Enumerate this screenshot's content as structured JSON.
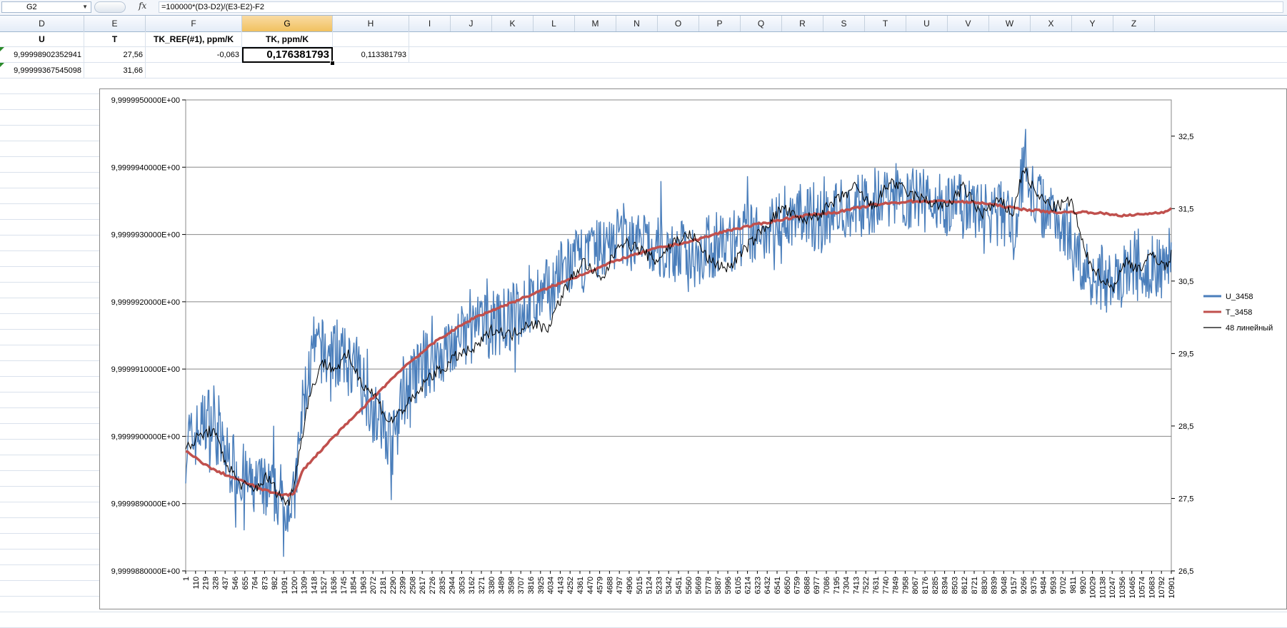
{
  "formula_bar": {
    "name_box": "G2",
    "fx_icon": "fx-icon",
    "formula": "=100000*(D3-D2)/(E3-E2)-F2"
  },
  "columns": [
    "D",
    "E",
    "F",
    "G",
    "H",
    "I",
    "J",
    "K",
    "L",
    "M",
    "N",
    "O",
    "P",
    "Q",
    "R",
    "S",
    "T",
    "U",
    "V",
    "W",
    "X",
    "Y",
    "Z"
  ],
  "selected_column": "G",
  "row1": {
    "d": "U",
    "e": "T",
    "f": "TK_REF(#1), ppm/K",
    "g": "TK, ppm/K"
  },
  "row2": {
    "d": "9,99998902352941",
    "e": "27,56",
    "f": "-0,063",
    "g": "0,176381793",
    "h": "0,113381793"
  },
  "row3": {
    "d": "9,99999367545098",
    "e": "31,66"
  },
  "colors": {
    "u_series": "#4a7ebb",
    "t_series": "#c0504d",
    "ma_series": "#000000",
    "selected_header": "#f1c15f"
  },
  "chart_data": {
    "type": "line",
    "title": "",
    "x_tick_labels": [
      "1",
      "110",
      "219",
      "328",
      "437",
      "546",
      "655",
      "764",
      "873",
      "982",
      "1091",
      "1200",
      "1309",
      "1418",
      "1527",
      "1636",
      "1745",
      "1854",
      "1963",
      "2072",
      "2181",
      "2290",
      "2399",
      "2508",
      "2617",
      "2726",
      "2835",
      "2944",
      "3053",
      "3162",
      "3271",
      "3380",
      "3489",
      "3598",
      "3707",
      "3816",
      "3925",
      "4034",
      "4143",
      "4252",
      "4361",
      "4470",
      "4579",
      "4688",
      "4797",
      "4906",
      "5015",
      "5124",
      "5233",
      "5342",
      "5451",
      "5560",
      "5669",
      "5778",
      "5887",
      "5996",
      "6105",
      "6214",
      "6323",
      "6432",
      "6541",
      "6650",
      "6759",
      "6868",
      "6977",
      "7086",
      "7195",
      "7304",
      "7413",
      "7522",
      "7631",
      "7740",
      "7849",
      "7958",
      "8067",
      "8176",
      "8285",
      "8394",
      "8503",
      "8612",
      "8721",
      "8830",
      "8939",
      "9048",
      "9157",
      "9266",
      "9375",
      "9484",
      "9593",
      "9702",
      "9811",
      "9920",
      "10029",
      "10138",
      "10247",
      "10356",
      "10465",
      "10574",
      "10683",
      "10792",
      "10901"
    ],
    "x_range": [
      1,
      10901
    ],
    "y_left": {
      "labels": [
        "9,9999950000E+00",
        "9,9999940000E+00",
        "9,9999930000E+00",
        "9,9999920000E+00",
        "9,9999910000E+00",
        "9,9999900000E+00",
        "9,9999890000E+00",
        "9,9999880000E+00"
      ],
      "range": [
        9.999988,
        9.999995
      ]
    },
    "y_right": {
      "labels": [
        "32,5",
        "31,5",
        "30,5",
        "29,5",
        "28,5",
        "27,5",
        "26,5"
      ],
      "range": [
        26.5,
        33.0
      ]
    },
    "grid": true,
    "legend_position": "right",
    "series": [
      {
        "name": "U_3458",
        "axis": "left",
        "color": "#4a7ebb",
        "x": [
          1,
          250,
          450,
          700,
          900,
          1100,
          1200,
          1300,
          1420,
          1650,
          1900,
          2100,
          2300,
          2400,
          2600,
          2900,
          3200,
          3500,
          3900,
          4200,
          4500,
          4800,
          5200,
          5600,
          6000,
          6300,
          6600,
          7000,
          7400,
          7800,
          8200,
          8600,
          9000,
          9200,
          9266,
          9400,
          9700,
          9900,
          10100,
          10300,
          10500,
          10800,
          10901
        ],
        "y": [
          9.9999898,
          9.9999903,
          9.9999897,
          9.9999893,
          9.9999892,
          9.9999891,
          9.999989,
          9.9999905,
          9.9999913,
          9.9999912,
          9.999991,
          9.9999903,
          9.9999899,
          9.9999906,
          9.999991,
          9.9999913,
          9.9999916,
          9.9999917,
          9.999992,
          9.9999925,
          9.9999927,
          9.999993,
          9.9999928,
          9.9999927,
          9.9999929,
          9.999993,
          9.9999933,
          9.9999932,
          9.9999934,
          9.9999936,
          9.9999935,
          9.9999934,
          9.9999933,
          9.9999932,
          9.9999941,
          9.9999935,
          9.9999932,
          9.9999925,
          9.9999924,
          9.9999922,
          9.9999926,
          9.9999925,
          9.9999928
        ]
      },
      {
        "name": "T_3458",
        "axis": "right",
        "color": "#c0504d",
        "x": [
          1,
          300,
          600,
          900,
          1100,
          1200,
          1300,
          1600,
          2000,
          2400,
          2800,
          3200,
          3600,
          4000,
          4400,
          4800,
          5200,
          5600,
          6000,
          6400,
          6800,
          7200,
          7600,
          8000,
          8400,
          8800,
          9200,
          9600,
          10000,
          10400,
          10800,
          10901
        ],
        "y": [
          28.15,
          27.9,
          27.75,
          27.6,
          27.55,
          27.56,
          27.9,
          28.3,
          28.8,
          29.3,
          29.7,
          30.0,
          30.2,
          30.4,
          30.6,
          30.8,
          30.95,
          31.05,
          31.2,
          31.3,
          31.4,
          31.45,
          31.55,
          31.6,
          31.6,
          31.58,
          31.5,
          31.45,
          31.45,
          31.4,
          31.45,
          31.5
        ]
      },
      {
        "name": "48 линейный",
        "axis": "left",
        "color": "#000000",
        "x": [
          1,
          150,
          300,
          450,
          600,
          750,
          900,
          1050,
          1150,
          1250,
          1350,
          1500,
          1650,
          1800,
          1950,
          2100,
          2250,
          2400,
          2550,
          2700,
          2850,
          3000,
          3200,
          3400,
          3600,
          3800,
          4000,
          4200,
          4400,
          4600,
          4800,
          5000,
          5200,
          5400,
          5600,
          5800,
          6000,
          6200,
          6400,
          6600,
          6800,
          7000,
          7200,
          7400,
          7600,
          7800,
          8000,
          8200,
          8400,
          8600,
          8800,
          9000,
          9150,
          9266,
          9400,
          9600,
          9800,
          9950,
          10100,
          10250,
          10400,
          10550,
          10700,
          10850,
          10901
        ],
        "y": [
          9.9999898,
          9.99999,
          9.9999901,
          9.9999896,
          9.9999893,
          9.9999892,
          9.9999894,
          9.9999891,
          9.999989,
          9.9999897,
          9.9999905,
          9.9999911,
          9.999991,
          9.9999912,
          9.9999908,
          9.9999906,
          9.9999902,
          9.9999904,
          9.9999906,
          9.9999909,
          9.999991,
          9.9999912,
          9.9999913,
          9.9999916,
          9.9999915,
          9.9999917,
          9.9999916,
          9.9999922,
          9.9999926,
          9.9999923,
          9.9999929,
          9.9999928,
          9.9999926,
          9.9999929,
          9.999993,
          9.9999926,
          9.9999925,
          9.9999928,
          9.9999931,
          9.9999934,
          9.9999932,
          9.9999933,
          9.9999935,
          9.9999937,
          9.9999934,
          9.9999938,
          9.9999936,
          9.9999935,
          9.9999934,
          9.9999937,
          9.9999933,
          9.9999935,
          9.9999933,
          9.999994,
          9.9999936,
          9.9999934,
          9.9999935,
          9.9999927,
          9.9999924,
          9.9999922,
          9.9999926,
          9.9999925,
          9.9999927,
          9.9999925,
          9.9999927
        ]
      }
    ]
  }
}
